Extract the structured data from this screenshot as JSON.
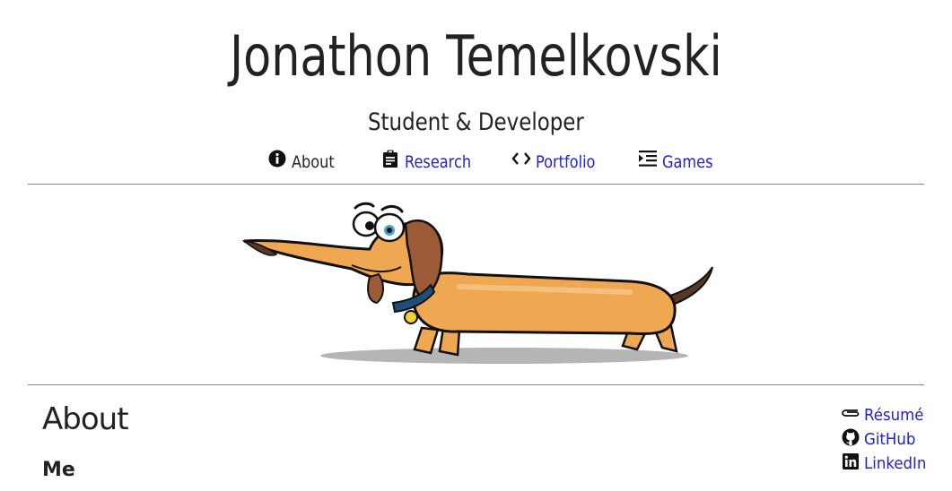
{
  "header": {
    "title": "Jonathon Temelkovski",
    "subtitle": "Student & Developer"
  },
  "nav": {
    "items": [
      {
        "label": "About",
        "icon": "info-icon",
        "active": true
      },
      {
        "label": "Research",
        "icon": "clipboard-icon",
        "active": false
      },
      {
        "label": "Portfolio",
        "icon": "code-icon",
        "active": false
      },
      {
        "label": "Games",
        "icon": "indent-icon",
        "active": false
      }
    ]
  },
  "hero": {
    "image": "cartoon-dachshund-illustration"
  },
  "main": {
    "heading": "About",
    "subheading": "Me"
  },
  "side_links": [
    {
      "label": "Résumé",
      "icon": "paperclip-icon"
    },
    {
      "label": "GitHub",
      "icon": "github-icon"
    },
    {
      "label": "LinkedIn",
      "icon": "linkedin-icon"
    }
  ],
  "colors": {
    "link": "#2222cc",
    "text": "#222222",
    "rule": "#8a8a8a",
    "dog_body": "#f0a752",
    "dog_ear": "#9c5a36",
    "dog_collar": "#1e4f7a"
  }
}
